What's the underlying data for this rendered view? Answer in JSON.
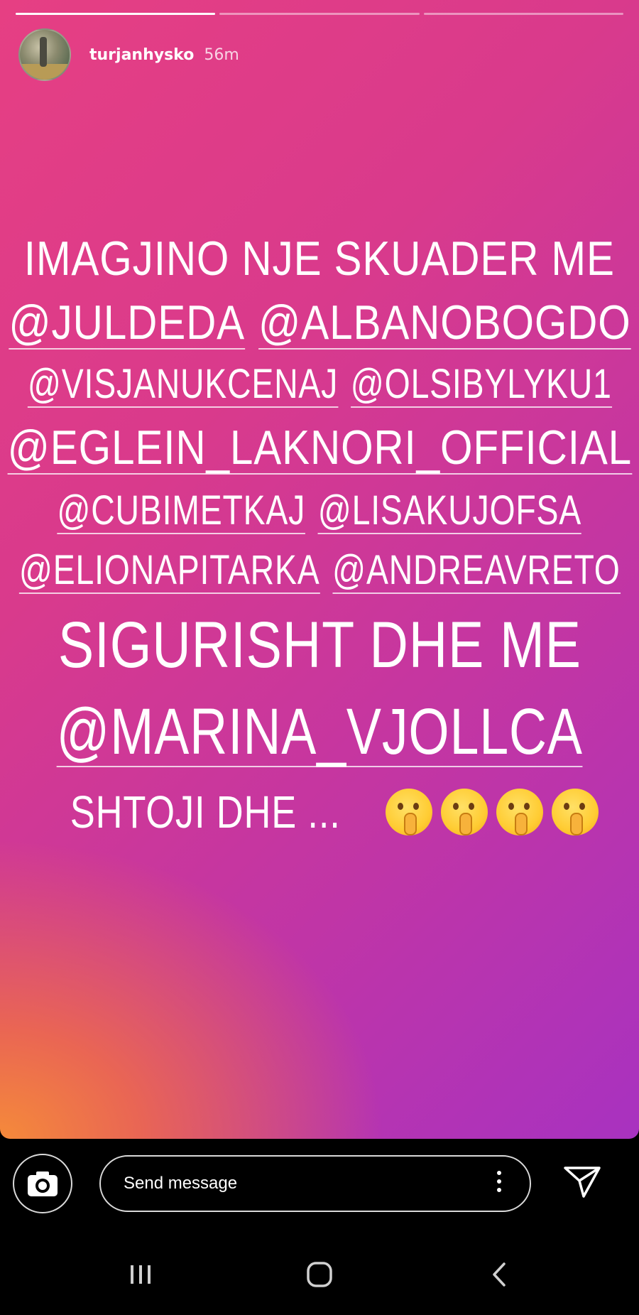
{
  "story": {
    "progress": [
      1.0,
      0.0,
      0.0
    ],
    "username": "turjanhysko",
    "time": "56m",
    "lines": {
      "line1": "IMAGJINO NJE SKUADER ME",
      "line2a": "@JULDEDA",
      "line2b": "@ALBANOBOGDO",
      "line3a": "@VISJANUKCENAJ",
      "line3b": "@OLSIBYLYKU1",
      "line4": "@EGLEIN_LAKNORI_OFFICIAL",
      "line5a": "@CUBIMETKAJ",
      "line5b": "@LISAKUJOFSA",
      "line6a": "@ELIONAPITARKA",
      "line6b": "@ANDREAVRETO",
      "line7": "SIGURISHT DHE ME",
      "line8": "@MARINA_VJOLLCA",
      "line9": "SHTOJI DHE ..."
    },
    "emoji_icon": "shushing-face-icon",
    "emoji_count": 4
  },
  "composer": {
    "placeholder": "Send message",
    "camera_icon": "camera-icon",
    "more_icon": "more-vertical-icon",
    "send_icon": "send-icon"
  },
  "navbar": {
    "recents_icon": "recents-icon",
    "home_icon": "home-icon",
    "back_icon": "back-icon"
  }
}
